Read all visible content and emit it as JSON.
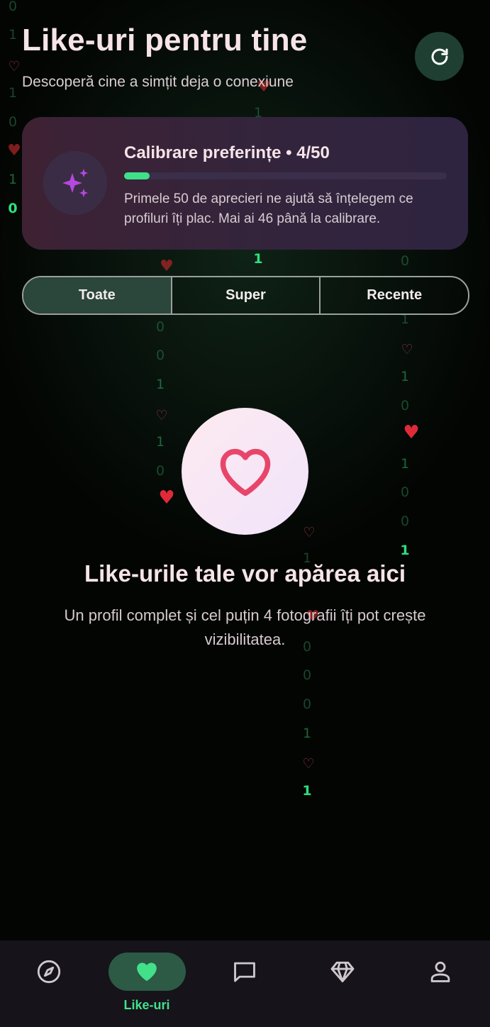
{
  "header": {
    "title": "Like-uri pentru tine",
    "subtitle": "Descoperă cine a simțit deja o conexiune",
    "refresh_icon": "refresh-icon"
  },
  "calibration": {
    "title": "Calibrare preferințe • 4/50",
    "progress": 0.08,
    "description": "Primele 50 de aprecieri ne ajută să înțelegem ce profiluri îți plac. Mai ai 46 până la calibrare.",
    "icon": "sparkles-icon"
  },
  "filters": {
    "tabs": [
      {
        "label": "Toate",
        "active": true
      },
      {
        "label": "Super",
        "active": false
      },
      {
        "label": "Recente",
        "active": false
      }
    ]
  },
  "empty_state": {
    "icon": "heart-outline-icon",
    "title": "Like-urile tale vor apărea aici",
    "description": "Un profil complet și cel puțin 4 fotografii îți pot crește vizibilitatea."
  },
  "bottom_nav": {
    "items": [
      {
        "icon": "compass-icon",
        "label": "",
        "active": false
      },
      {
        "icon": "heart-icon",
        "label": "Like-uri",
        "active": true
      },
      {
        "icon": "chat-icon",
        "label": "",
        "active": false
      },
      {
        "icon": "diamond-icon",
        "label": "",
        "active": false
      },
      {
        "icon": "profile-icon",
        "label": "",
        "active": false
      }
    ]
  },
  "colors": {
    "background": "#030503",
    "accent_green": "#3fe08a",
    "heart_pink": "#e8456a",
    "sparkle_purple": "#b548e0",
    "card_background": "#3a2336",
    "nav_background": "#16131b"
  }
}
